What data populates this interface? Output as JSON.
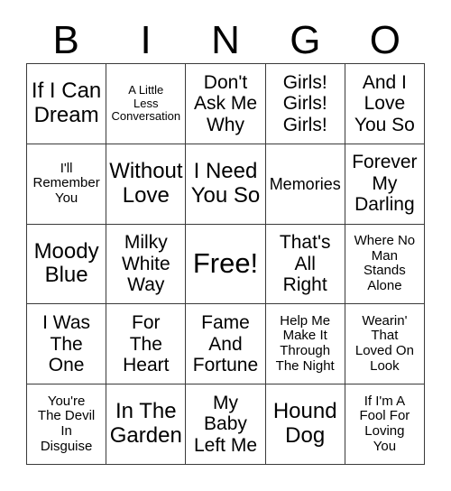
{
  "card": {
    "title_letters": [
      "B",
      "I",
      "N",
      "G",
      "O"
    ],
    "columns": 5,
    "rows": 5,
    "free_space_label": "Free!",
    "cells": [
      {
        "text": "If I Can\nDream",
        "size": "s-xl"
      },
      {
        "text": "A Little\nLess\nConversation",
        "size": "s-xs"
      },
      {
        "text": "Don't\nAsk Me\nWhy",
        "size": "s-lg"
      },
      {
        "text": "Girls!\nGirls!\nGirls!",
        "size": "s-lg"
      },
      {
        "text": "And I\nLove\nYou So",
        "size": "s-lg"
      },
      {
        "text": "I'll\nRemember\nYou",
        "size": "s-sm"
      },
      {
        "text": "Without\nLove",
        "size": "s-xl"
      },
      {
        "text": "I Need\nYou So",
        "size": "s-xl"
      },
      {
        "text": "Memories",
        "size": "s-md"
      },
      {
        "text": "Forever\nMy\nDarling",
        "size": "s-lg"
      },
      {
        "text": "Moody\nBlue",
        "size": "s-xl"
      },
      {
        "text": "Milky\nWhite\nWay",
        "size": "s-lg"
      },
      {
        "text": "Free!",
        "size": "s-xxl"
      },
      {
        "text": "That's\nAll\nRight",
        "size": "s-lg"
      },
      {
        "text": "Where No\nMan\nStands\nAlone",
        "size": "s-sm"
      },
      {
        "text": "I Was\nThe\nOne",
        "size": "s-lg"
      },
      {
        "text": "For\nThe\nHeart",
        "size": "s-lg"
      },
      {
        "text": "Fame\nAnd\nFortune",
        "size": "s-lg"
      },
      {
        "text": "Help Me\nMake It\nThrough\nThe Night",
        "size": "s-sm"
      },
      {
        "text": "Wearin'\nThat\nLoved On\nLook",
        "size": "s-sm"
      },
      {
        "text": "You're\nThe Devil\nIn\nDisguise",
        "size": "s-sm"
      },
      {
        "text": "In The\nGarden",
        "size": "s-xl"
      },
      {
        "text": "My\nBaby\nLeft Me",
        "size": "s-lg"
      },
      {
        "text": "Hound\nDog",
        "size": "s-xl"
      },
      {
        "text": "If I'm A\nFool For\nLoving\nYou",
        "size": "s-sm"
      }
    ]
  },
  "colors": {
    "border": "#3a3a3a",
    "text": "#000000",
    "background": "#ffffff"
  }
}
